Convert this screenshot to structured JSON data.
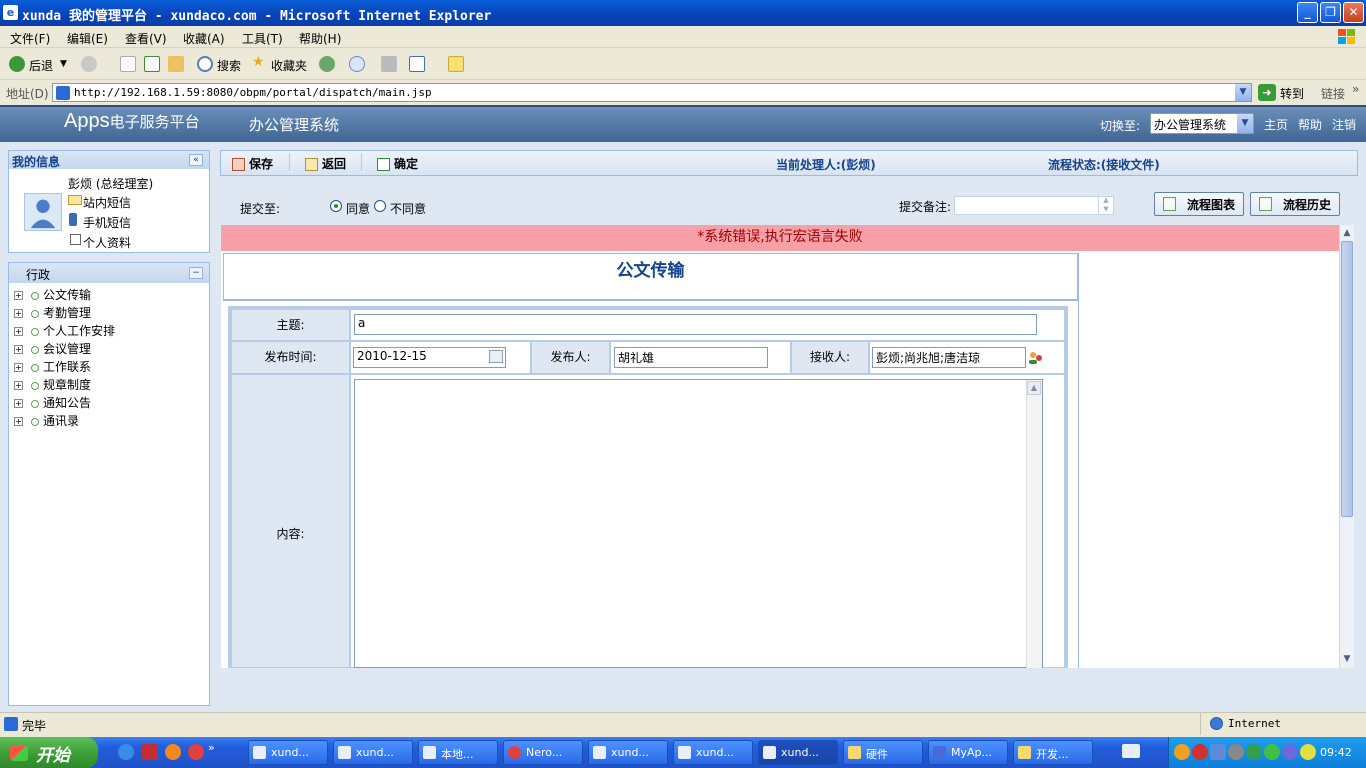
{
  "window": {
    "title": "xunda 我的管理平台 - xundaco.com - Microsoft Internet Explorer",
    "buttons": {
      "minimize": "_",
      "restore": "❐",
      "close": "✕"
    }
  },
  "menu": [
    "文件(F)",
    "编辑(E)",
    "查看(V)",
    "收藏(A)",
    "工具(T)",
    "帮助(H)"
  ],
  "toolbar": {
    "back": "后退",
    "search": "搜索",
    "favorites": "收藏夹"
  },
  "address": {
    "label": "地址(D)",
    "url": "http://192.168.1.59:8080/obpm/portal/dispatch/main.jsp",
    "go": "转到",
    "links": "链接"
  },
  "app": {
    "logo_apps": "Apps",
    "logo_text": "电子服务平台",
    "system_name": "办公管理系统",
    "switch_label": "切换至:",
    "switch_value": "办公管理系统",
    "links": [
      "主页",
      "帮助",
      "注销"
    ]
  },
  "my_info": {
    "header": "我的信息",
    "user": "彭烦 (总经理室)",
    "links": [
      "站内短信",
      "手机短信",
      "个人资料"
    ]
  },
  "nav": {
    "header": "行政",
    "items": [
      "公文传输",
      "考勤管理",
      "个人工作安排",
      "会议管理",
      "工作联系",
      "规章制度",
      "通知公告",
      "通讯录"
    ]
  },
  "form_toolbar": {
    "save": "保存",
    "back": "返回",
    "confirm": "确定",
    "current_handler": "当前处理人:(彭烦)",
    "flow_state": "流程状态:(接收文件)"
  },
  "submit": {
    "label": "提交至:",
    "agree": "同意",
    "disagree": "不同意",
    "note_label": "提交备注:",
    "note_value": "",
    "flow_chart": "流程图表",
    "flow_history": "流程历史"
  },
  "error": "*系统错误,执行宏语言失败",
  "document": {
    "title": "公文传输",
    "subject_label": "主题:",
    "subject_value": "a",
    "date_label": "发布时间:",
    "date_value": "2010-12-15",
    "publisher_label": "发布人:",
    "publisher_value": "胡礼雄",
    "receiver_label": "接收人:",
    "receiver_value": "彭烦;尚兆旭;唐洁琼",
    "content_label": "内容:",
    "content_value": ""
  },
  "status": {
    "text": "完毕",
    "zone": "Internet"
  },
  "taskbar": {
    "start": "开始",
    "tasks": [
      "xund...",
      "xund...",
      "本地...",
      "Nero...",
      "xund...",
      "xund...",
      "xund...",
      "硬件",
      "MyAp...",
      "开发..."
    ],
    "clock": "09:42"
  }
}
